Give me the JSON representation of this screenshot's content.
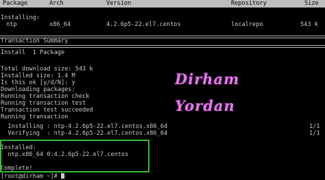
{
  "table_header": {
    "package": "Package",
    "arch": "Arch",
    "version": "Version",
    "repository": "Repository",
    "size": "Size"
  },
  "installing_label": "Installing:",
  "package_row": {
    "name": "ntp",
    "arch": "x86_64",
    "version": "4.2.6p5-22.el7.centos",
    "repo": "localrepo",
    "size": "543 k"
  },
  "transaction_summary": "Transaction Summary",
  "install_count": "Install  1 Package",
  "log_lines": [
    "Total download size: 543 k",
    "Installed size: 1.4 M",
    "Is this ok [y/d/N]: y",
    "Downloading packages:",
    "Running transaction check",
    "Running transaction test",
    "Transaction test succeeded",
    "Running transaction"
  ],
  "progress": [
    {
      "label": "  Installing : ntp-4.2.6p5-22.el7.centos.x86_64",
      "count": "1/1"
    },
    {
      "label": "  Verifying  : ntp-4.2.6p5-22.el7.centos.x86_64",
      "count": "1/1"
    }
  ],
  "installed_label": "Installed:",
  "installed_pkg": "  ntp.x86_64 0:4.2.6p5-22.el7.centos",
  "complete": "Complete!",
  "prompt": "[root@dirham ~]#",
  "watermark": {
    "line1": "Dirham",
    "line2": "Yordan",
    "color": "#e07be6"
  },
  "highlight_color": "#2fbf3a"
}
